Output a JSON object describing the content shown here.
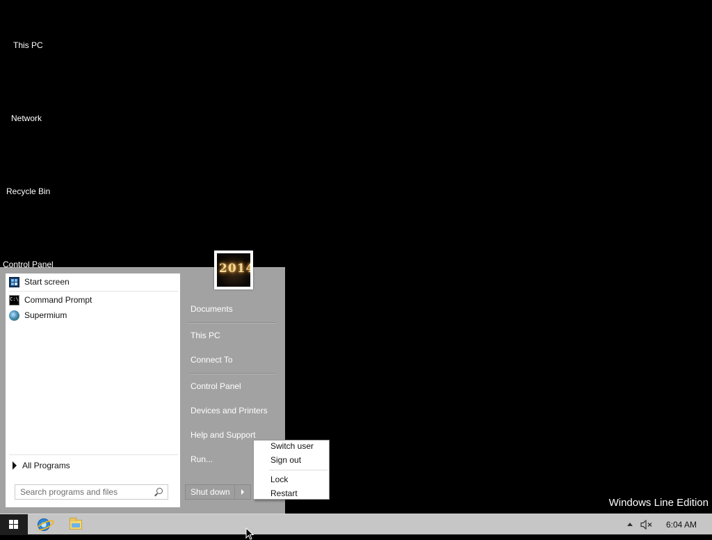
{
  "desktop": {
    "icons": [
      {
        "label": "This PC"
      },
      {
        "label": "Network"
      },
      {
        "label": "Recycle Bin"
      },
      {
        "label": "Control Panel"
      }
    ],
    "watermark": "Windows Line Edition"
  },
  "start_menu": {
    "avatar_text": "2014",
    "programs": [
      {
        "label": "Start screen",
        "icon": "start-screen-icon"
      },
      {
        "label": "Command Prompt",
        "icon": "command-prompt-icon"
      },
      {
        "label": "Supermium",
        "icon": "supermium-icon"
      }
    ],
    "all_programs": "All Programs",
    "search": {
      "placeholder": "Search programs and files",
      "value": ""
    },
    "right_links": [
      {
        "label": "Documents"
      },
      {
        "label": "This PC"
      },
      {
        "label": "Connect To"
      },
      {
        "label": "Control Panel"
      },
      {
        "label": "Devices and Printers"
      },
      {
        "label": "Help and Support"
      },
      {
        "label": "Run..."
      }
    ],
    "shutdown_label": "Shut down",
    "power_menu": [
      {
        "label": "Switch user"
      },
      {
        "label": "Sign out"
      },
      {
        "label": "Lock"
      },
      {
        "label": "Restart"
      }
    ]
  },
  "taskbar": {
    "pinned": [
      "internet-explorer-icon",
      "file-explorer-icon"
    ],
    "tray": {
      "volume_state": "muted",
      "clock": "6:04 AM"
    }
  },
  "colors": {
    "desktop_bg": "#000000",
    "start_menu_bg": "#a2a2a2",
    "taskbar_bg": "#c6c6c6",
    "start_button_bg": "#1e1e1e"
  }
}
